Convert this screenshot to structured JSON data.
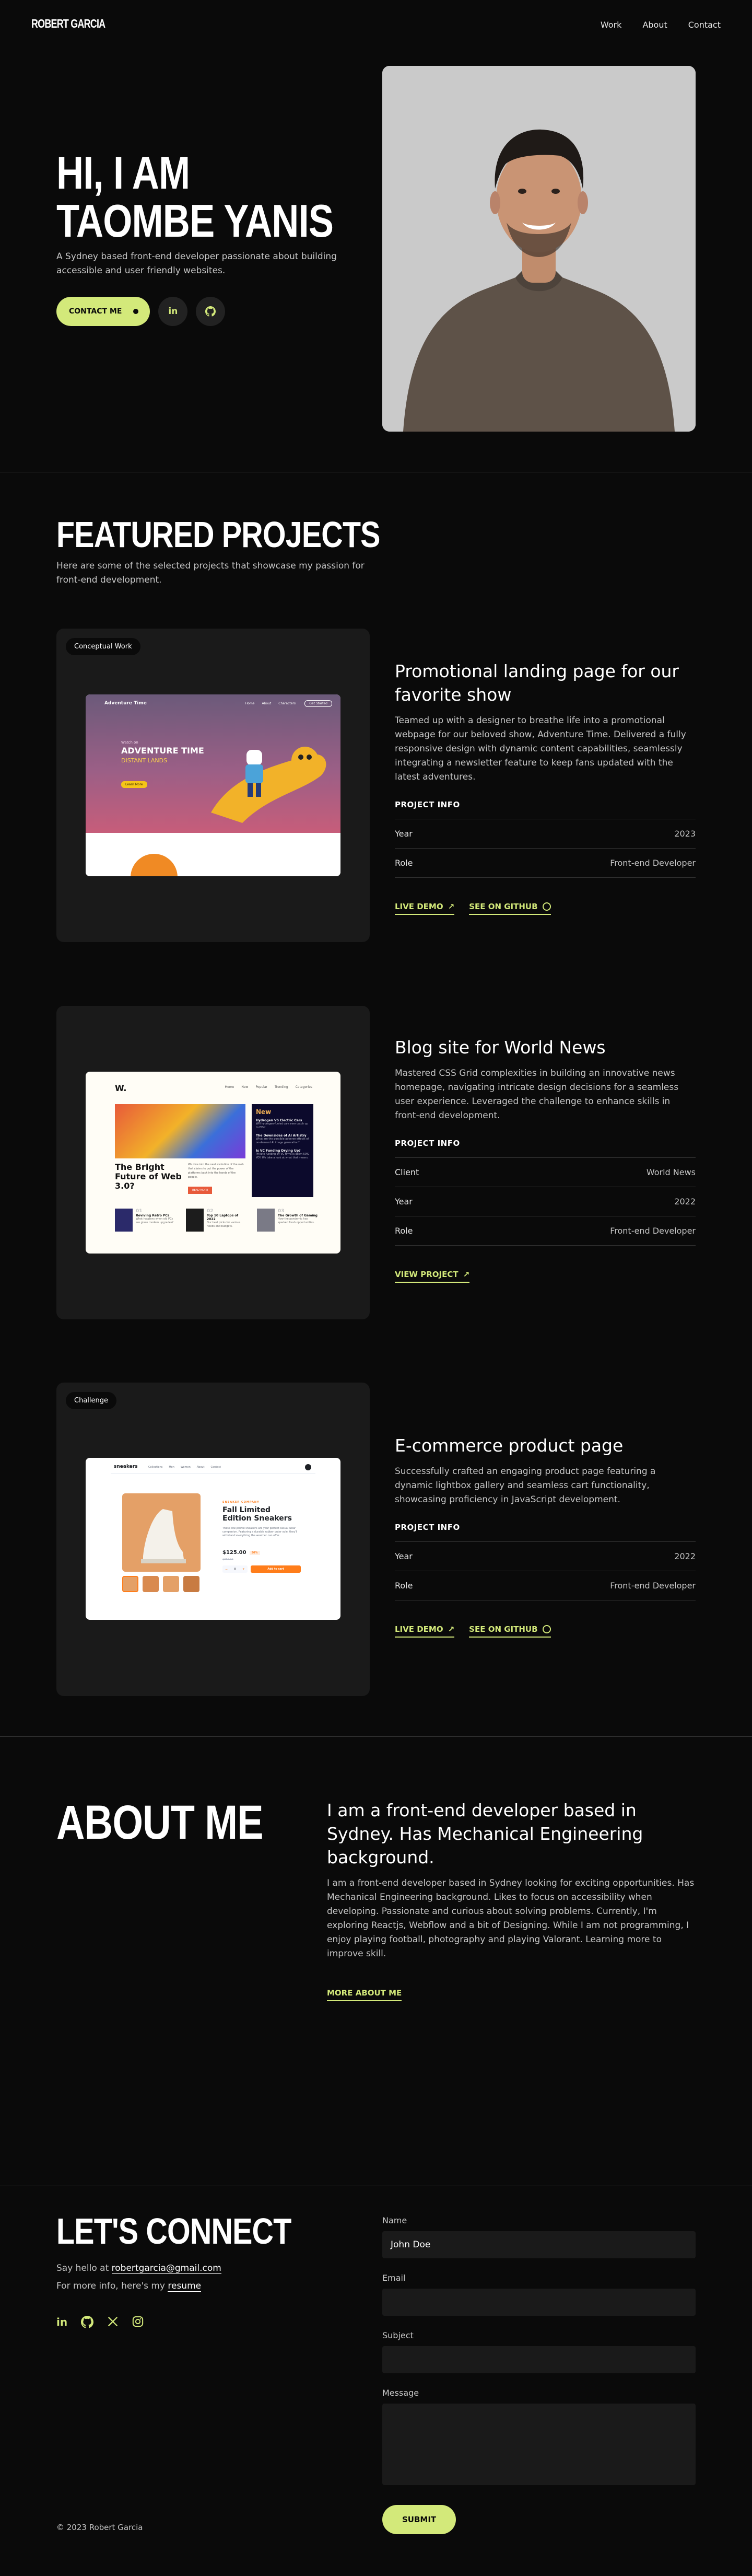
{
  "header": {
    "logo": "ROBERT GARCIA",
    "nav": [
      "Work",
      "About",
      "Contact"
    ]
  },
  "hero": {
    "title_line1": "HI, I AM",
    "title_line2": "TAOMBE YANIS",
    "subtitle": "A Sydney based front-end developer passionate about building accessible and user friendly websites.",
    "contact_button": "CONTACT ME",
    "linkedin_label": "in"
  },
  "projects": {
    "title": "FEATURED PROJECTS",
    "subtitle": "Here are some of the selected projects that showcase my passion for front-end development.",
    "info_label": "PROJECT INFO",
    "items": [
      {
        "tag": "Conceptual Work",
        "title": "Promotional landing page for our favorite show",
        "description": "Teamed up with a designer to breathe life into a promotional webpage for our beloved show, Adventure Time. Delivered a fully responsive design with dynamic content capabilities, seamlessly integrating a newsletter feature to keep fans updated with the latest adventures.",
        "rows": [
          {
            "label": "Year",
            "value": "2023"
          },
          {
            "label": "Role",
            "value": "Front-end Developer"
          }
        ],
        "links": [
          "LIVE DEMO",
          "SEE ON GITHUB"
        ],
        "shot": {
          "brand": "Adventure Time",
          "nav": [
            "Home",
            "About",
            "Characters"
          ],
          "nav_button": "Get Started",
          "kicker": "Watch on",
          "headline": "ADVENTURE TIME",
          "sub": "DISTANT LANDS",
          "cta": "Learn More"
        }
      },
      {
        "tag": "",
        "title": "Blog site for World News",
        "description": "Mastered CSS Grid complexities in building an innovative news homepage, navigating intricate design decisions for a seamless user experience. Leveraged the challenge to enhance skills in  front-end development.",
        "rows": [
          {
            "label": "Client",
            "value": "World News"
          },
          {
            "label": "Year",
            "value": "2022"
          },
          {
            "label": "Role",
            "value": "Front-end Developer"
          }
        ],
        "links": [
          "VIEW PROJECT"
        ],
        "shot": {
          "logo": "W.",
          "nav": [
            "Home",
            "New",
            "Popular",
            "Trending",
            "Categories"
          ],
          "headline": "The Bright Future of Web 3.0?",
          "body": "We dive into the next evolution of the web that claims to put the power of the platforms back into the hands of the people.",
          "cta": "READ MORE",
          "side_title": "New",
          "side_items": [
            {
              "title": "Hydrogen VS Electric Cars",
              "body": "Will hydrogen-fueled cars ever catch up to EVs?"
            },
            {
              "title": "The Downsides of AI Artistry",
              "body": "What are the possible adverse effects of on-demand AI image generation?"
            },
            {
              "title": "Is VC Funding Drying Up?",
              "body": "Private funding by VC firms is down 50% YOY. We take a look at what that means."
            }
          ],
          "bottom": [
            {
              "num": "01",
              "title": "Reviving Retro PCs",
              "body": "What happens when old PCs are given modern upgrades?"
            },
            {
              "num": "02",
              "title": "Top 10 Laptops of 2022",
              "body": "Our best picks for various needs and budgets."
            },
            {
              "num": "03",
              "title": "The Growth of Gaming",
              "body": "How the pandemic has sparked fresh opportunities."
            }
          ]
        }
      },
      {
        "tag": "Challenge",
        "title": "E-commerce product page",
        "description": "Successfully crafted an engaging product page featuring a dynamic lightbox gallery and seamless cart functionality, showcasing proficiency in JavaScript development.",
        "rows": [
          {
            "label": "Year",
            "value": "2022"
          },
          {
            "label": "Role",
            "value": "Front-end Developer"
          }
        ],
        "links": [
          "LIVE DEMO",
          "SEE ON GITHUB"
        ],
        "shot": {
          "logo": "sneakers",
          "nav": [
            "Collections",
            "Men",
            "Women",
            "About",
            "Contact"
          ],
          "kicker": "SNEAKER COMPANY",
          "headline": "Fall Limited Edition Sneakers",
          "body": "These low-profile sneakers are your perfect casual wear companion. Featuring a durable rubber outer sole, they'll withstand everything the weather can offer.",
          "price": "$125.00",
          "discount": "50%",
          "old_price": "$250.00",
          "qty": "0",
          "cta": "Add to cart"
        }
      }
    ]
  },
  "about": {
    "title": "ABOUT ME",
    "heading": "I am a front-end developer based in Sydney. Has Mechanical Engineering background.",
    "body": "I am a front-end developer based in Sydney looking for exciting opportunities. Has Mechanical Engineering background. Likes to focus on accessibility when developing. Passionate and curious about solving problems. Currently, I'm exploring Reactjs, Webflow and a bit of Designing. While I am not programming, I enjoy playing football, photography and playing Valorant. Learning more to improve skill.",
    "link": "MORE ABOUT ME"
  },
  "contact": {
    "title": "LET'S CONNECT",
    "say_hello": "Say hello at",
    "email": "robertgarcia@gmail.com",
    "more_info": "For more info, here's my",
    "resume": "resume",
    "social_linkedin": "in",
    "copyright": "© 2023 Robert Garcia",
    "form": {
      "name_label": "Name",
      "name_value": "John Doe",
      "email_label": "Email",
      "subject_label": "Subject",
      "message_label": "Message",
      "submit": "SUBMIT"
    }
  },
  "colors": {
    "accent": "#d3e97a",
    "background": "#0a0a0a",
    "card": "#1a1a1a",
    "divider": "#333333"
  }
}
